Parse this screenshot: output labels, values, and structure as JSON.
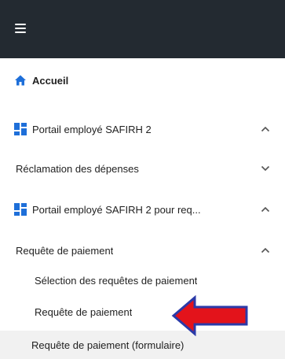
{
  "topbar": {
    "menu_icon": "hamburger-menu-icon"
  },
  "menu": {
    "home": {
      "label": "Accueil",
      "icon": "home-icon"
    },
    "portal1": {
      "label": "Portail employé SAFIRH 2",
      "icon": "dashboard-icon",
      "expanded": true
    },
    "expenses": {
      "label": "Réclamation des dépenses",
      "expanded": false
    },
    "portal2": {
      "label": "Portail employé SAFIRH 2 pour req...",
      "icon": "dashboard-icon",
      "expanded": true
    },
    "payment_request": {
      "label": "Requête de paiement",
      "expanded": true
    },
    "sub_items": [
      {
        "label": "Sélection des requêtes de paiement"
      },
      {
        "label": "Requête de paiement"
      },
      {
        "label": "Requête de paiement (formulaire)"
      }
    ]
  },
  "colors": {
    "topbar": "#232a31",
    "accent_blue": "#1e6fd9",
    "arrow_red": "#e3131b",
    "arrow_outline": "#2b3aa8",
    "highlight_bg": "#f1f1f1"
  }
}
